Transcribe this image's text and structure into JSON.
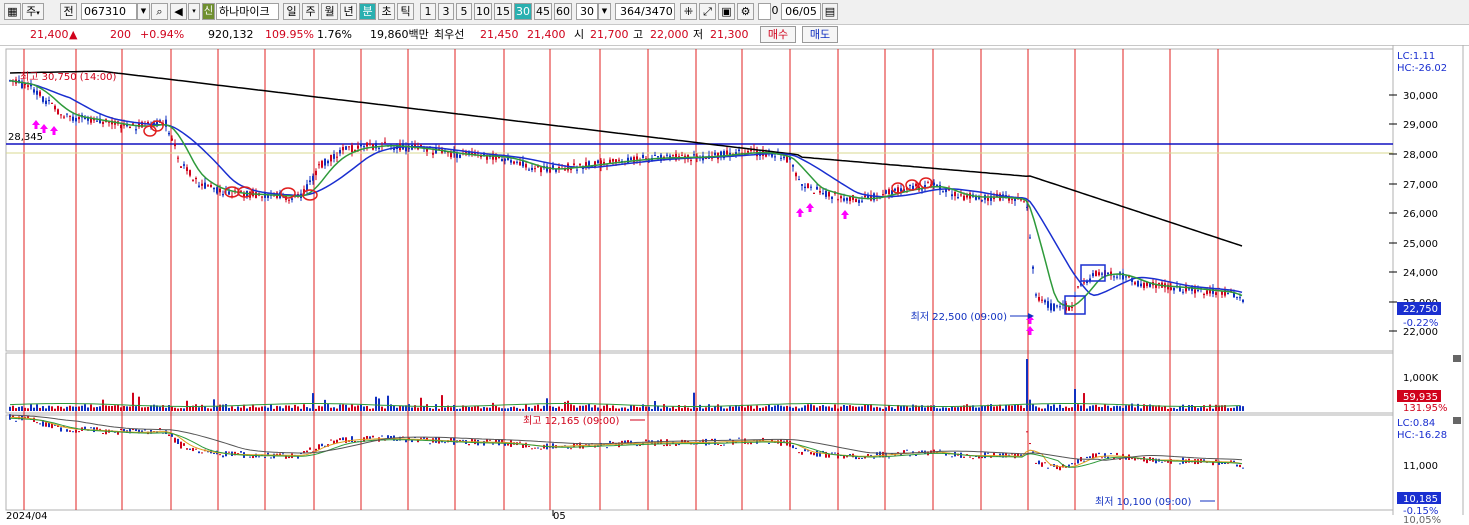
{
  "toolbar": {
    "type_label": "주",
    "type_toggle": "전",
    "code_value": "067310",
    "stock_name": "하나마이크",
    "period_units": [
      "일",
      "주",
      "월",
      "년",
      "분",
      "초",
      "틱"
    ],
    "period_units_selected": "분",
    "minute_intervals": [
      "1",
      "3",
      "5",
      "10",
      "15",
      "30",
      "45",
      "60"
    ],
    "minute_selected": "30",
    "interval_value": "30",
    "count_value": "364",
    "count_total": "/3470",
    "date_value": "06/05",
    "checkbox_label": "0"
  },
  "quote": {
    "price": "21,400",
    "change_arrow": "▲",
    "change": "200",
    "change_pct": "+0.94%",
    "volume": "920,132",
    "volume_ratio": "109.95%",
    "turnover": "1.76%",
    "amount": "19,860백만",
    "priority_label": "최우선",
    "ask": "21,450",
    "bid": "21,400",
    "open_label": "시",
    "open": "21,700",
    "high_label": "고",
    "high": "22,000",
    "low_label": "저",
    "low": "21,300",
    "buy_button": "매수",
    "sell_button": "매도"
  },
  "main_panel": {
    "lc_label": "LC:1.11",
    "hc_label": "HC:-26.02",
    "y_ticks": [
      "30,000",
      "29,000",
      "28,000",
      "27,000",
      "26,000",
      "25,000",
      "24,000",
      "23,000",
      "22,000"
    ],
    "high_annotation": "최고 30,750 (14:00)",
    "low_annotation": "최저 22,500 (09:00)",
    "hline_label": "28,345",
    "current_price_box": "22,750",
    "current_pct": "-0.22%"
  },
  "volume_panel": {
    "y_tick": "1,000K",
    "current_box": "59,935",
    "current_pct": "131.95%"
  },
  "lower_panel": {
    "lc_label": "LC:0.84",
    "hc_label": "HC:-16.28",
    "y_tick": "11,000",
    "high_annotation": "최고 12,165 (09:00)",
    "low_annotation": "최저 10,100 (09:00)",
    "current_box": "10,185",
    "current_pct": "-0.15%"
  },
  "x_axis": {
    "labels": [
      "2024/04",
      "05"
    ],
    "cutoff_label": "10,05%"
  },
  "colors": {
    "up": "#d0021b",
    "down": "#1030c0",
    "ma_blue": "#1a2fd0",
    "ma_green": "#2e9a3a",
    "ma_black": "#000000",
    "hline": "#1010c0",
    "marker": "#ff00ff",
    "accent": "#2c9a9a"
  }
}
